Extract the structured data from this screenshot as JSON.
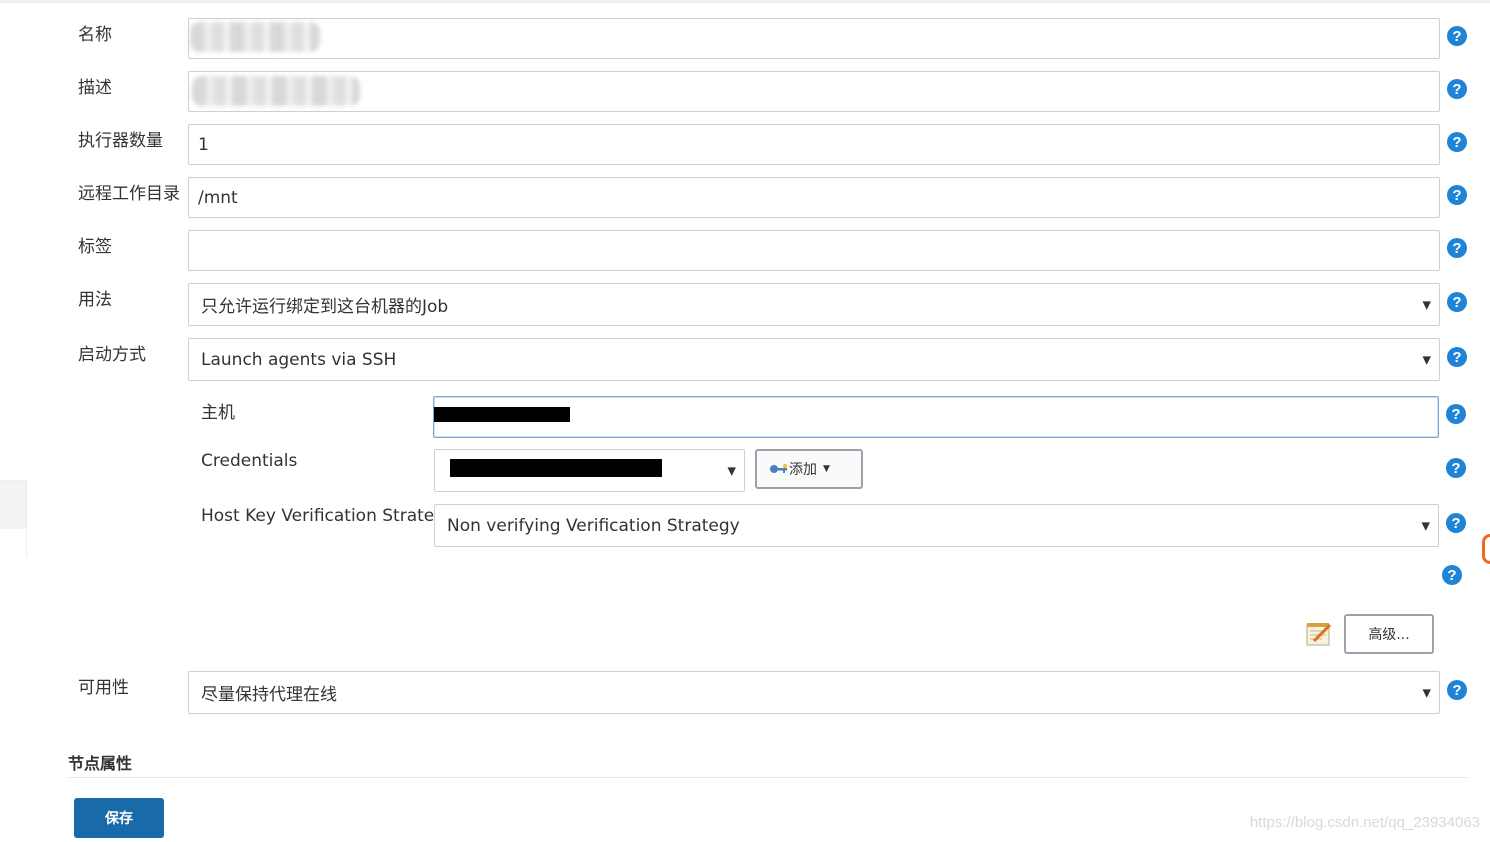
{
  "form": {
    "name": {
      "label": "名称",
      "value": ""
    },
    "description": {
      "label": "描述",
      "value": ""
    },
    "executors": {
      "label": "执行器数量",
      "value": "1"
    },
    "remote_root": {
      "label": "远程工作目录",
      "value": "/mnt"
    },
    "labels": {
      "label": "标签",
      "value": ""
    },
    "usage": {
      "label": "用法",
      "value": "只允许运行绑定到这台机器的Job"
    },
    "launch_method": {
      "label": "启动方式",
      "value": "Launch agents via SSH"
    },
    "host": {
      "label": "主机",
      "value": ""
    },
    "credentials": {
      "label": "Credentials",
      "value": "",
      "add_button": "添加"
    },
    "host_key_strategy": {
      "label": "Host Key Verification Strategy",
      "value": "Non verifying Verification Strategy"
    },
    "advanced_button": "高级...",
    "availability": {
      "label": "可用性",
      "value": "尽量保持代理在线"
    }
  },
  "section": {
    "node_properties": "节点属性"
  },
  "actions": {
    "save": "保存"
  },
  "help_glyph": "?",
  "watermark": "https://blog.csdn.net/qq_23934063",
  "colors": {
    "help": "#1f84d6",
    "save_button": "#186aa8",
    "focus_border": "#7ea6d6"
  }
}
